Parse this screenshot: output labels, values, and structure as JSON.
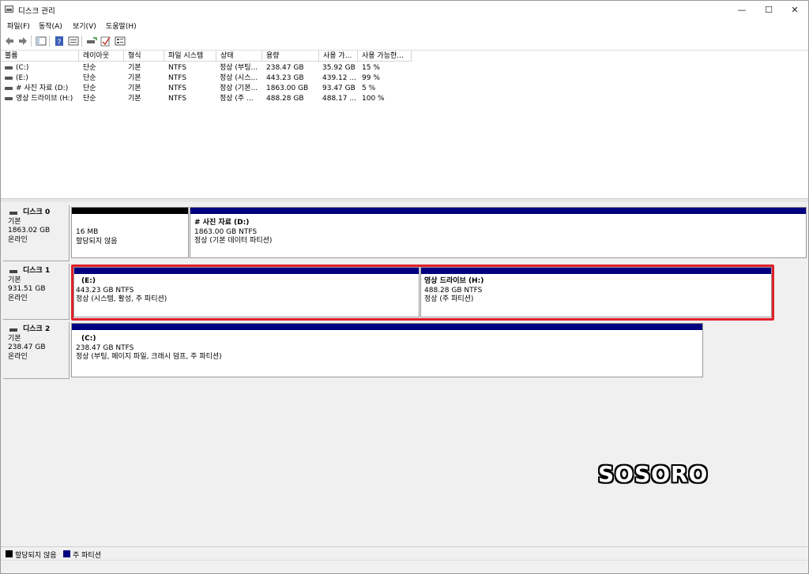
{
  "window": {
    "title": "디스크 관리",
    "minimize": "—",
    "maximize": "☐",
    "close": "✕"
  },
  "menu": [
    "파일(F)",
    "동작(A)",
    "보기(V)",
    "도움말(H)"
  ],
  "toolbar": [
    "back-icon",
    "forward-icon",
    "console-tree-icon",
    "help-icon",
    "properties-icon",
    "connect-icon",
    "check-icon",
    "view-icon"
  ],
  "volume_list": {
    "columns": [
      "볼륨",
      "레이아웃",
      "형식",
      "파일 시스템",
      "상태",
      "용량",
      "사용 가...",
      "사용 가능한..."
    ],
    "rows": [
      [
        "(C:)",
        "단순",
        "기본",
        "NTFS",
        "정상 (부팅...",
        "238.47 GB",
        "35.92 GB",
        "15 %"
      ],
      [
        "(E:)",
        "단순",
        "기본",
        "NTFS",
        "정상 (시스...",
        "443.23 GB",
        "439.12 ...",
        "99 %"
      ],
      [
        "# 사진 자료 (D:)",
        "단순",
        "기본",
        "NTFS",
        "정상 (기본...",
        "1863.00 GB",
        "93.47 GB",
        "5 %"
      ],
      [
        "영상 드라이브 (H:)",
        "단순",
        "기본",
        "NTFS",
        "정상 (주 ...",
        "488.28 GB",
        "488.17 ...",
        "100 %"
      ]
    ]
  },
  "disks": [
    {
      "name": "디스크 0",
      "type": "기본",
      "size": "1863.02 GB",
      "status": "온라인",
      "partitions": [
        {
          "name": "",
          "size": "16 MB",
          "status": "할당되지 않음",
          "color": "#000000"
        },
        {
          "name": "# 사진 자료  (D:)",
          "size": "1863.00 GB NTFS",
          "status": "정상 (기본 데이터 파티션)",
          "color": "#000080"
        }
      ]
    },
    {
      "name": "디스크 1",
      "type": "기본",
      "size": "931.51 GB",
      "status": "온라인",
      "partitions": [
        {
          "name": "(E:)",
          "size": "443.23 GB NTFS",
          "status": "정상 (시스템, 활성, 주 파티션)",
          "color": "#000080"
        },
        {
          "name": "영상 드라이브  (H:)",
          "size": "488.28 GB NTFS",
          "status": "정상 (주 파티션)",
          "color": "#000080"
        }
      ]
    },
    {
      "name": "디스크 2",
      "type": "기본",
      "size": "238.47 GB",
      "status": "온라인",
      "partitions": [
        {
          "name": "(C:)",
          "size": "238.47 GB NTFS",
          "status": "정상 (부팅, 페이지 파일, 크래시 덤프, 주 파티션)",
          "color": "#000080"
        }
      ]
    }
  ],
  "legend": [
    {
      "label": "할당되지 않음",
      "color": "#000000"
    },
    {
      "label": "주 파티션",
      "color": "#000080"
    }
  ],
  "watermark": "SOSORO"
}
